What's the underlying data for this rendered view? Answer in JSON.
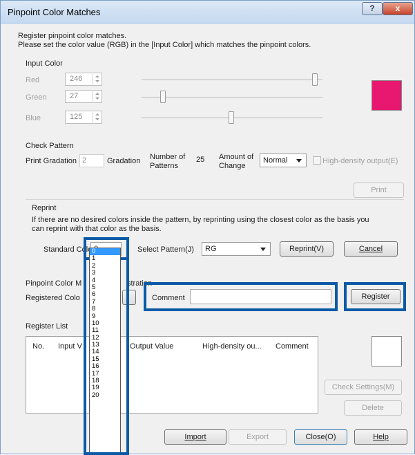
{
  "window": {
    "title": "Pinpoint Color Matches",
    "help_glyph": "?",
    "close_glyph": "x"
  },
  "intro": {
    "line1": "Register pinpoint color matches.",
    "line2": "Please set the color value (RGB) in the [Input Color] which matches the pinpoint colors."
  },
  "input_color": {
    "label": "Input Color",
    "red_label": "Red",
    "red_value": "246",
    "green_label": "Green",
    "green_value": "27",
    "blue_label": "Blue",
    "blue_value": "125",
    "swatch_color": "#e8176f"
  },
  "check_pattern": {
    "label": "Check Pattern",
    "print_gradation_label": "Print Gradation",
    "print_gradation_value": "2",
    "gradation_label": "Gradation",
    "number_of_patterns_label1": "Number of",
    "number_of_patterns_label2": "Patterns",
    "number_of_patterns_value": "25",
    "amount_label1": "Amount of",
    "amount_label2": "Change",
    "amount_value": "Normal",
    "high_density_label": "High-density output(E)",
    "print_button": "Print"
  },
  "reprint": {
    "label": "Reprint",
    "desc1": "If there are no desired colors inside the pattern, by reprinting using the closest color as the basis you",
    "desc2": "can reprint with that color as the basis.",
    "standard_color_label": "Standard Colc",
    "standard_color_value": "0",
    "select_pattern_label": "Select Pattern(J)",
    "select_pattern_value": "RG",
    "reprint_button": "Reprint(V)",
    "cancel_button": "Cancel"
  },
  "registration": {
    "section_label_a": "Pinpoint Color M",
    "section_label_b": "stration",
    "registered_color_label": "Registered Colo",
    "comment_label": "Comment",
    "comment_value": "",
    "register_button": "Register"
  },
  "register_list": {
    "label": "Register List",
    "columns": [
      "No.",
      "Input V",
      "Output Value",
      "High-density ou...",
      "Comment"
    ],
    "check_settings_button": "Check Settings(M)",
    "delete_button": "Delete"
  },
  "footer": {
    "import_button": "Import",
    "export_button": "Export",
    "close_button": "Close(O)",
    "help_button": "Help"
  },
  "dropdown_options": [
    "0",
    "1",
    "2",
    "3",
    "4",
    "5",
    "6",
    "7",
    "8",
    "9",
    "10",
    "11",
    "12",
    "13",
    "14",
    "15",
    "16",
    "17",
    "18",
    "19",
    "20"
  ],
  "highlight_color": "#0b5aa6"
}
